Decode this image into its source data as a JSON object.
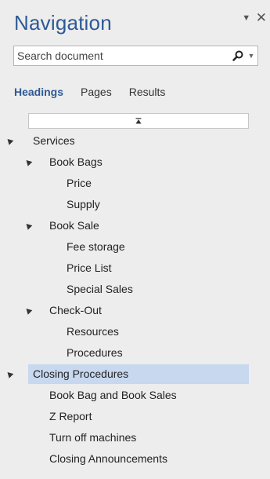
{
  "pane": {
    "title": "Navigation",
    "dropdown_icon": "chevron-down-icon",
    "close_icon": "close-icon"
  },
  "search": {
    "placeholder": "Search document",
    "icon": "search-icon"
  },
  "tabs": [
    {
      "label": "Headings",
      "active": true
    },
    {
      "label": "Pages",
      "active": false
    },
    {
      "label": "Results",
      "active": false
    }
  ],
  "tree": [
    {
      "label": "Services",
      "level": 0,
      "expandable": true,
      "selected": false
    },
    {
      "label": "Book Bags",
      "level": 1,
      "expandable": true,
      "selected": false
    },
    {
      "label": "Price",
      "level": 2,
      "expandable": false,
      "selected": false
    },
    {
      "label": "Supply",
      "level": 2,
      "expandable": false,
      "selected": false
    },
    {
      "label": "Book Sale",
      "level": 1,
      "expandable": true,
      "selected": false
    },
    {
      "label": "Fee storage",
      "level": 2,
      "expandable": false,
      "selected": false
    },
    {
      "label": "Price List",
      "level": 2,
      "expandable": false,
      "selected": false
    },
    {
      "label": "Special Sales",
      "level": 2,
      "expandable": false,
      "selected": false
    },
    {
      "label": "Check-Out",
      "level": 1,
      "expandable": true,
      "selected": false
    },
    {
      "label": "Resources",
      "level": 2,
      "expandable": false,
      "selected": false
    },
    {
      "label": "Procedures",
      "level": 2,
      "expandable": false,
      "selected": false
    },
    {
      "label": "Closing Procedures",
      "level": 0,
      "expandable": true,
      "selected": true
    },
    {
      "label": "Book Bag and Book Sales",
      "level": 1,
      "expandable": false,
      "selected": false
    },
    {
      "label": "Z Report",
      "level": 1,
      "expandable": false,
      "selected": false
    },
    {
      "label": "Turn off machines",
      "level": 1,
      "expandable": false,
      "selected": false
    },
    {
      "label": "Closing Announcements",
      "level": 1,
      "expandable": false,
      "selected": false
    }
  ],
  "colors": {
    "accent": "#2e5a94",
    "selected_row": "#c7d8ef",
    "pane_bg": "#ededed"
  }
}
